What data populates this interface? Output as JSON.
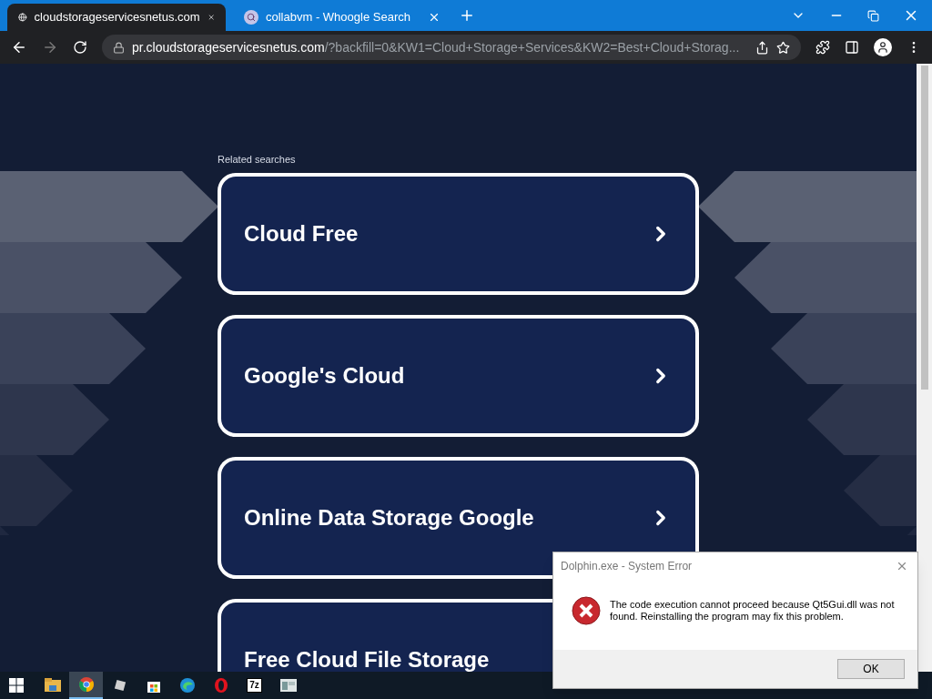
{
  "tabs": [
    {
      "title": "cloudstorageservicesnetus.com",
      "selected": true,
      "kind": "globe"
    },
    {
      "title": "collabvm - Whoogle Search",
      "selected": false,
      "kind": "search"
    }
  ],
  "address_bar": {
    "host": "pr.cloudstorageservicesnetus.com",
    "path": "/?backfill=0&KW1=Cloud+Storage+Services&KW2=Best+Cloud+Storag..."
  },
  "page": {
    "heading": "Related searches",
    "links": [
      "Cloud Free",
      "Google's Cloud",
      "Online Data Storage Google",
      "Free Cloud File Storage"
    ]
  },
  "dialog": {
    "title": "Dolphin.exe - System Error",
    "message": "The code execution cannot proceed because Qt5Gui.dll was not found. Reinstalling the program may fix this problem.",
    "button": "OK"
  },
  "taskbar": {
    "items": [
      {
        "kind": "folder",
        "active": false
      },
      {
        "kind": "chrome",
        "active": true
      },
      {
        "kind": "cube",
        "active": false
      },
      {
        "kind": "store",
        "active": false
      },
      {
        "kind": "edge",
        "active": false
      },
      {
        "kind": "opera",
        "active": false
      },
      {
        "kind": "archive",
        "label": "7z",
        "active": false
      },
      {
        "kind": "window",
        "active": false
      }
    ]
  }
}
